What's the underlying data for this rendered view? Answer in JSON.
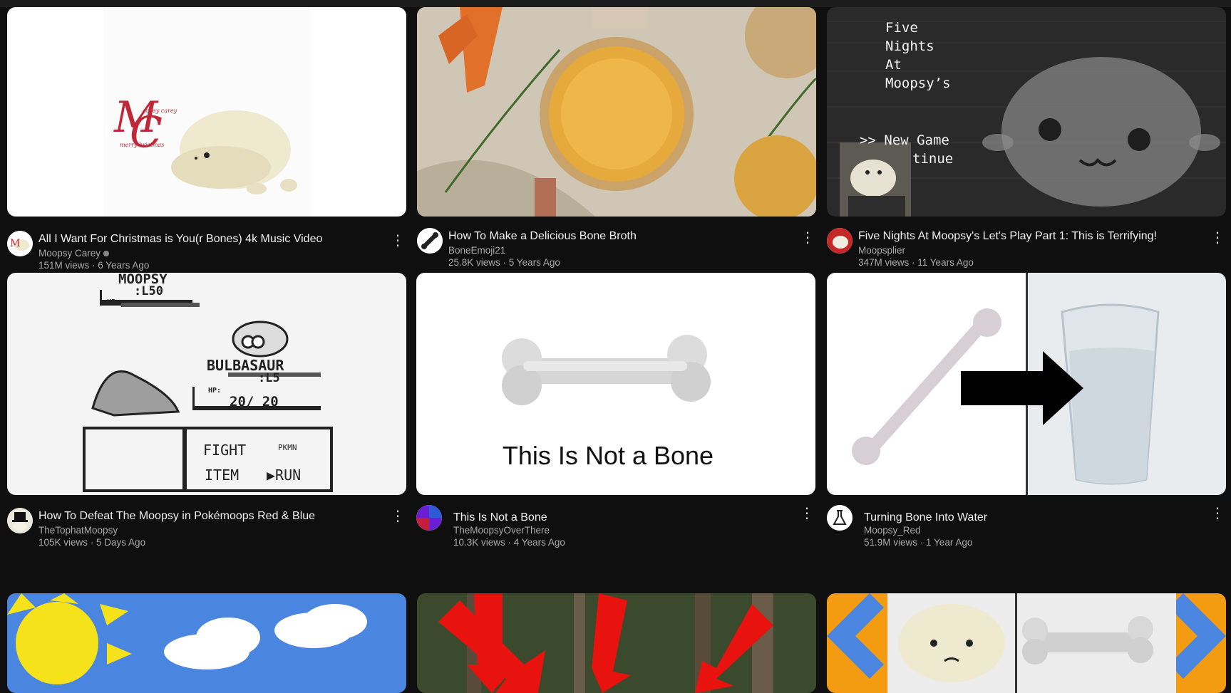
{
  "videos": [
    {
      "title": "All I Want For Christmas is You(r Bones) 4k Music Video",
      "channel": "Moopsy Carey",
      "stats": "151M views · 6 Years Ago",
      "thumb_text": "Moopsy carey merry Christmas"
    },
    {
      "title": "How To Make a Delicious Bone Broth",
      "channel": "BoneEmoji21",
      "stats": "25.8K views · 5 Years Ago"
    },
    {
      "title": "Five Nights At Moopsy's Let's Play Part 1: This is Terrifying!",
      "channel": "Moopsplier",
      "stats": "347M views · 11 Years Ago",
      "thumb_lines": [
        "Five",
        "Nights",
        "At",
        "Moopsy’s"
      ],
      "thumb_menu": ">> New Game",
      "thumb_menu2": "tinue"
    },
    {
      "title": "How To Defeat The Moopsy in Pokémoops Red & Blue",
      "channel": "TheTophatMoopsy",
      "stats": "105K views · 5 Days Ago",
      "thumb_enemy": "MOOPSY",
      "thumb_enemy_lv": ":L50",
      "thumb_player": "BULBASAUR",
      "thumb_player_lv": ":L5",
      "thumb_hp": "20/ 20",
      "thumb_hp_label": "HP:",
      "thumb_fight": "FIGHT",
      "thumb_pkmn": "PKMN",
      "thumb_item": "ITEM",
      "thumb_run": "▶RUN"
    },
    {
      "title": "This Is Not a Bone",
      "channel": "TheMoopsyOverThere",
      "stats": "10.3K views · 4 Years Ago",
      "thumb_caption": "This Is Not a Bone"
    },
    {
      "title": "Turning Bone Into Water",
      "channel": "Moopsy_Red",
      "stats": "51.9M views · 1 Year Ago"
    }
  ],
  "more_glyph": "⋮",
  "colors": {
    "bg": "#0f0f0f",
    "text": "#f1f1f1",
    "muted": "#aaaaaa"
  }
}
